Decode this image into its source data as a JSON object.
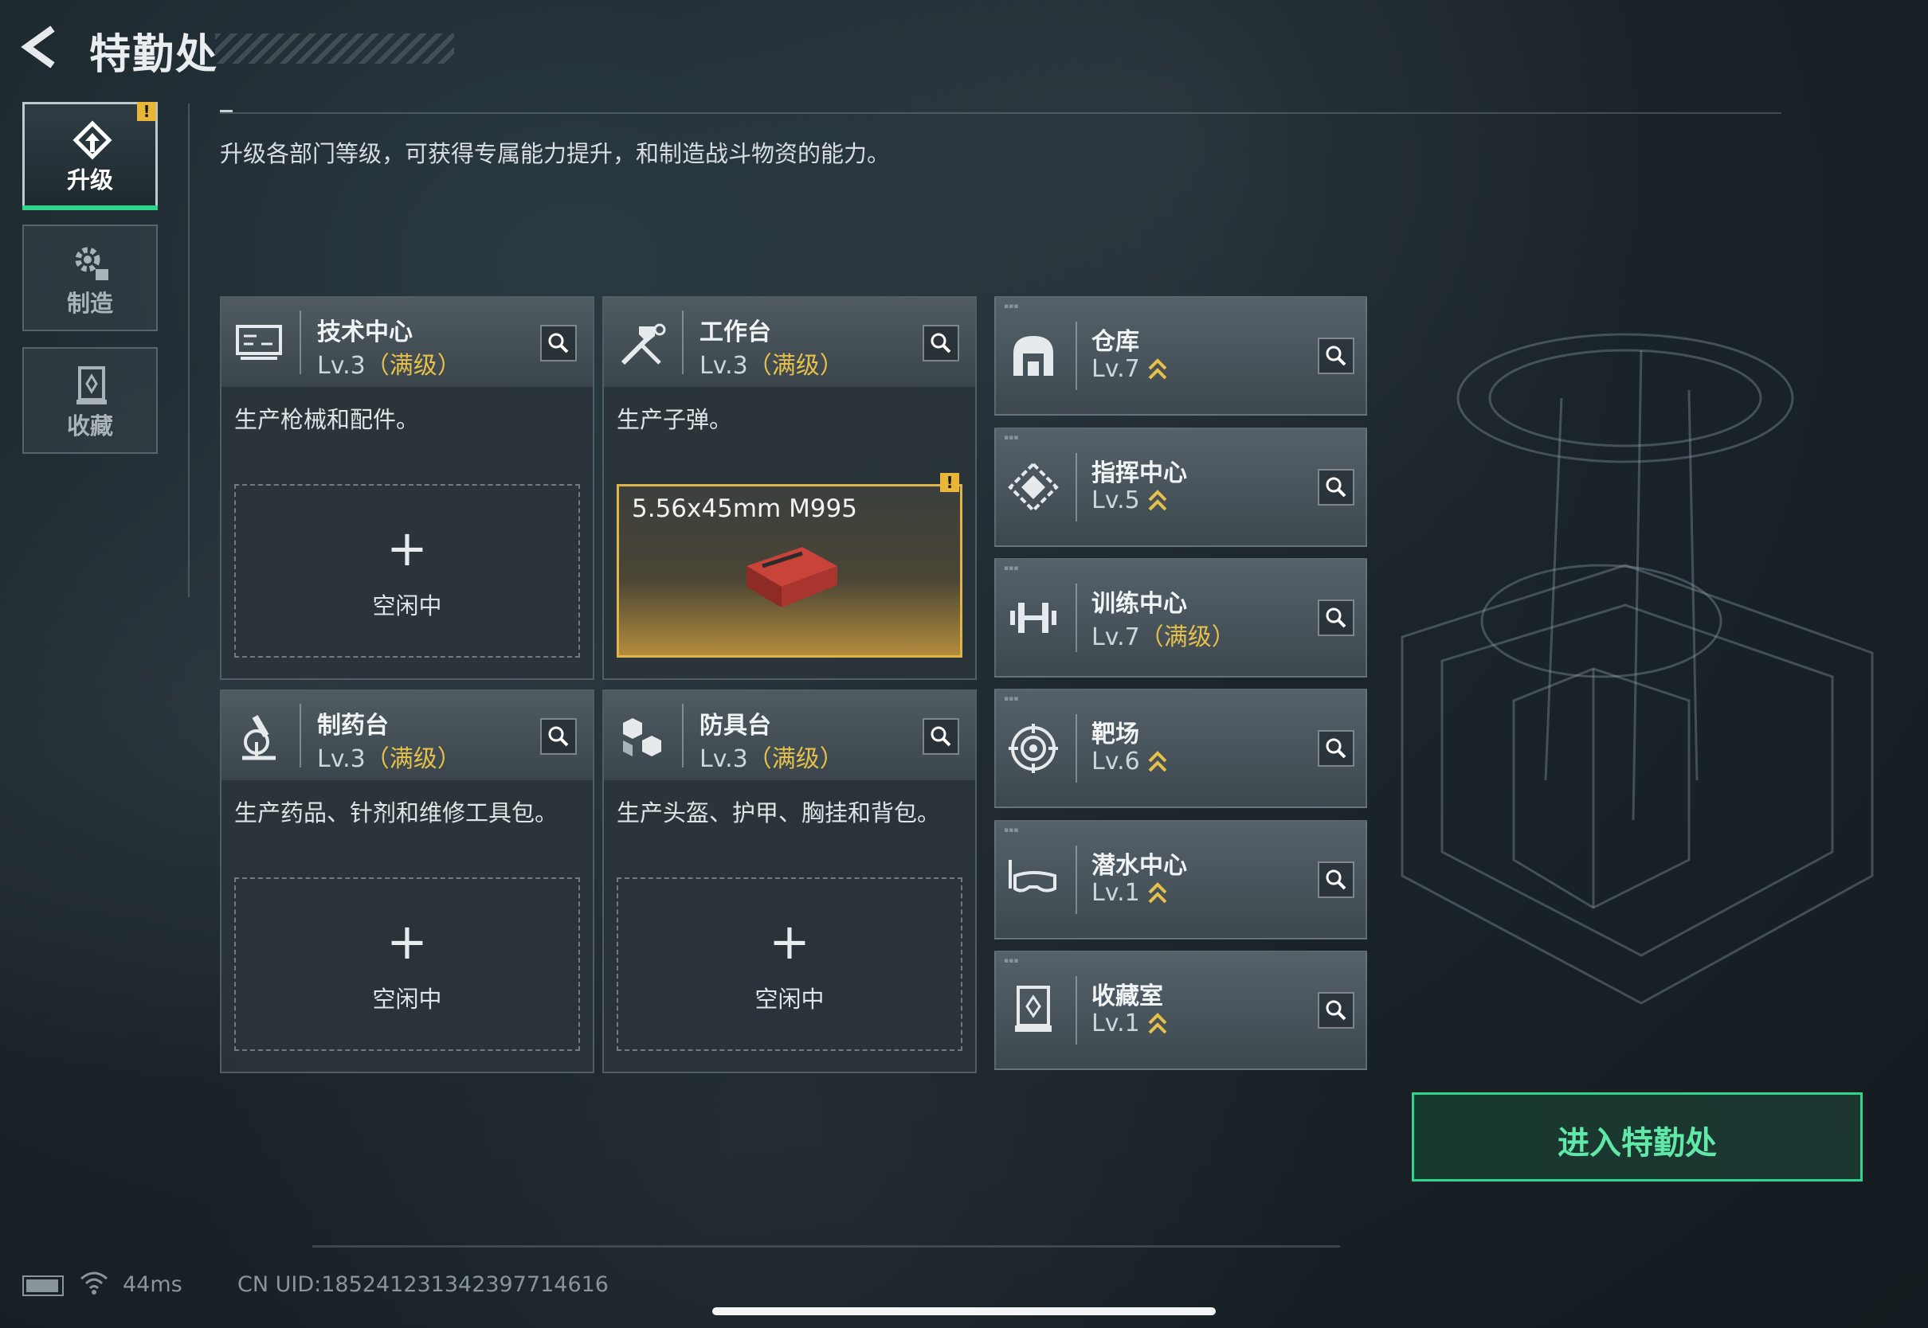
{
  "header": {
    "title": "特勤处"
  },
  "subtitle": "升级各部门等级，可获得专属能力提升，和制造战斗物资的能力。",
  "side_tabs": [
    {
      "label": "升级",
      "icon": "upgrade-icon",
      "active": true,
      "alert": "!"
    },
    {
      "label": "制造",
      "icon": "gears-icon",
      "active": false
    },
    {
      "label": "收藏",
      "icon": "trophy-case-icon",
      "active": false
    }
  ],
  "stations": [
    {
      "name": "技术中心",
      "level": "Lv.3",
      "max_tag": "（满级）",
      "desc": "生产枪械和配件。",
      "slot_plus": "+",
      "slot_status": "空闲中",
      "icon": "computer-icon"
    },
    {
      "name": "工作台",
      "level": "Lv.3",
      "max_tag": "（满级）",
      "desc": "生产子弹。",
      "crafting_item": "5.56x45mm M995",
      "alert": "!",
      "icon": "hammer-wrench-icon"
    },
    {
      "name": "制药台",
      "level": "Lv.3",
      "max_tag": "（满级）",
      "desc": "生产药品、针剂和维修工具包。",
      "slot_plus": "+",
      "slot_status": "空闲中",
      "icon": "microscope-icon"
    },
    {
      "name": "防具台",
      "level": "Lv.3",
      "max_tag": "（满级）",
      "desc": "生产头盔、护甲、胸挂和背包。",
      "slot_plus": "+",
      "slot_status": "空闲中",
      "icon": "boxes-icon"
    }
  ],
  "buildings": [
    {
      "name": "仓库",
      "level": "Lv.7",
      "max_tag": "",
      "upgradable": true,
      "icon": "warehouse-icon"
    },
    {
      "name": "指挥中心",
      "level": "Lv.5",
      "max_tag": "",
      "upgradable": true,
      "icon": "command-icon"
    },
    {
      "name": "训练中心",
      "level": "Lv.7",
      "max_tag": "（满级）",
      "upgradable": false,
      "icon": "dumbbell-icon"
    },
    {
      "name": "靶场",
      "level": "Lv.6",
      "max_tag": "",
      "upgradable": true,
      "icon": "target-icon"
    },
    {
      "name": "潜水中心",
      "level": "Lv.1",
      "max_tag": "",
      "upgradable": true,
      "icon": "diving-mask-icon"
    },
    {
      "name": "收藏室",
      "level": "Lv.1",
      "max_tag": "",
      "upgradable": true,
      "icon": "trophy-case-icon"
    }
  ],
  "enter_button": "进入特勤处",
  "footer": {
    "ping": "44ms",
    "uid": "CN UID:18524123134239771461​6"
  },
  "colors": {
    "accent_green": "#2fd58a",
    "max_gold": "#e5c04b",
    "alert_yellow": "#e8b73a"
  }
}
